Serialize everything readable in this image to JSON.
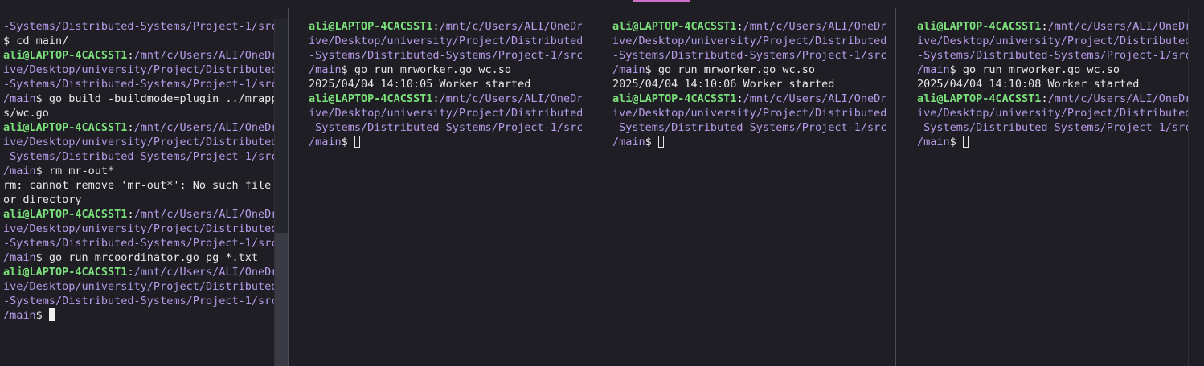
{
  "panes": [
    {
      "lines": [
        {
          "parts": [
            {
              "c": "p",
              "t": "-Systems/Distributed-Systems/Project-1/src"
            }
          ]
        },
        {
          "parts": [
            {
              "c": "w",
              "t": "$ cd main/"
            }
          ]
        },
        {
          "parts": [
            {
              "c": "g",
              "t": "ali@LAPTOP-4CACSST1"
            },
            {
              "c": "w",
              "t": ":"
            },
            {
              "c": "p",
              "t": "/mnt/c/Users/ALI/OneDr"
            }
          ]
        },
        {
          "parts": [
            {
              "c": "p",
              "t": "ive/Desktop/university/Project/Distributed"
            }
          ]
        },
        {
          "parts": [
            {
              "c": "p",
              "t": "-Systems/Distributed-Systems/Project-1/src"
            }
          ]
        },
        {
          "parts": [
            {
              "c": "p",
              "t": "/main"
            },
            {
              "c": "w",
              "t": "$ go build -buildmode=plugin ../mrapp"
            }
          ]
        },
        {
          "parts": [
            {
              "c": "w",
              "t": "s/wc.go"
            }
          ]
        },
        {
          "parts": [
            {
              "c": "g",
              "t": "ali@LAPTOP-4CACSST1"
            },
            {
              "c": "w",
              "t": ":"
            },
            {
              "c": "p",
              "t": "/mnt/c/Users/ALI/OneDr"
            }
          ]
        },
        {
          "parts": [
            {
              "c": "p",
              "t": "ive/Desktop/university/Project/Distributed"
            }
          ]
        },
        {
          "parts": [
            {
              "c": "p",
              "t": "-Systems/Distributed-Systems/Project-1/src"
            }
          ]
        },
        {
          "parts": [
            {
              "c": "p",
              "t": "/main"
            },
            {
              "c": "w",
              "t": "$ rm mr-out*"
            }
          ]
        },
        {
          "parts": [
            {
              "c": "w",
              "t": "rm: cannot remove 'mr-out*': No such file"
            }
          ]
        },
        {
          "parts": [
            {
              "c": "w",
              "t": "or directory"
            }
          ]
        },
        {
          "parts": [
            {
              "c": "g",
              "t": "ali@LAPTOP-4CACSST1"
            },
            {
              "c": "w",
              "t": ":"
            },
            {
              "c": "p",
              "t": "/mnt/c/Users/ALI/OneDr"
            }
          ]
        },
        {
          "parts": [
            {
              "c": "p",
              "t": "ive/Desktop/university/Project/Distributed"
            }
          ]
        },
        {
          "parts": [
            {
              "c": "p",
              "t": "-Systems/Distributed-Systems/Project-1/src"
            }
          ]
        },
        {
          "parts": [
            {
              "c": "p",
              "t": "/main"
            },
            {
              "c": "w",
              "t": "$ go run mrcoordinator.go pg-*.txt"
            }
          ]
        },
        {
          "parts": [
            {
              "c": "g",
              "t": "ali@LAPTOP-4CACSST1"
            },
            {
              "c": "w",
              "t": ":"
            },
            {
              "c": "p",
              "t": "/mnt/c/Users/ALI/OneDr"
            }
          ]
        },
        {
          "parts": [
            {
              "c": "p",
              "t": "ive/Desktop/university/Project/Distributed"
            }
          ]
        },
        {
          "parts": [
            {
              "c": "p",
              "t": "-Systems/Distributed-Systems/Project-1/src"
            }
          ]
        },
        {
          "parts": [
            {
              "c": "p",
              "t": "/main"
            },
            {
              "c": "w",
              "t": "$ "
            }
          ],
          "cursor": "block"
        }
      ]
    },
    {
      "lines": [
        {
          "parts": [
            {
              "c": "g",
              "t": "ali@LAPTOP-4CACSST1"
            },
            {
              "c": "w",
              "t": ":"
            },
            {
              "c": "p",
              "t": "/mnt/c/Users/ALI/OneDr"
            }
          ]
        },
        {
          "parts": [
            {
              "c": "p",
              "t": "ive/Desktop/university/Project/Distributed"
            }
          ]
        },
        {
          "parts": [
            {
              "c": "p",
              "t": "-Systems/Distributed-Systems/Project-1/src"
            }
          ]
        },
        {
          "parts": [
            {
              "c": "p",
              "t": "/main"
            },
            {
              "c": "w",
              "t": "$ go run mrworker.go wc.so"
            }
          ]
        },
        {
          "parts": [
            {
              "c": "w",
              "t": "2025/04/04 14:10:05 Worker started"
            }
          ]
        },
        {
          "parts": [
            {
              "c": "g",
              "t": "ali@LAPTOP-4CACSST1"
            },
            {
              "c": "w",
              "t": ":"
            },
            {
              "c": "p",
              "t": "/mnt/c/Users/ALI/OneDr"
            }
          ]
        },
        {
          "parts": [
            {
              "c": "p",
              "t": "ive/Desktop/university/Project/Distributed"
            }
          ]
        },
        {
          "parts": [
            {
              "c": "p",
              "t": "-Systems/Distributed-Systems/Project-1/src"
            }
          ]
        },
        {
          "parts": [
            {
              "c": "p",
              "t": "/main"
            },
            {
              "c": "w",
              "t": "$ "
            }
          ],
          "cursor": "hollow"
        }
      ]
    },
    {
      "lines": [
        {
          "parts": [
            {
              "c": "g",
              "t": "ali@LAPTOP-4CACSST1"
            },
            {
              "c": "w",
              "t": ":"
            },
            {
              "c": "p",
              "t": "/mnt/c/Users/ALI/OneDr"
            }
          ]
        },
        {
          "parts": [
            {
              "c": "p",
              "t": "ive/Desktop/university/Project/Distributed"
            }
          ]
        },
        {
          "parts": [
            {
              "c": "p",
              "t": "-Systems/Distributed-Systems/Project-1/src"
            }
          ]
        },
        {
          "parts": [
            {
              "c": "p",
              "t": "/main"
            },
            {
              "c": "w",
              "t": "$ go run mrworker.go wc.so"
            }
          ]
        },
        {
          "parts": [
            {
              "c": "w",
              "t": "2025/04/04 14:10:06 Worker started"
            }
          ]
        },
        {
          "parts": [
            {
              "c": "g",
              "t": "ali@LAPTOP-4CACSST1"
            },
            {
              "c": "w",
              "t": ":"
            },
            {
              "c": "p",
              "t": "/mnt/c/Users/ALI/OneDr"
            }
          ]
        },
        {
          "parts": [
            {
              "c": "p",
              "t": "ive/Desktop/university/Project/Distributed"
            }
          ]
        },
        {
          "parts": [
            {
              "c": "p",
              "t": "-Systems/Distributed-Systems/Project-1/src"
            }
          ]
        },
        {
          "parts": [
            {
              "c": "p",
              "t": "/main"
            },
            {
              "c": "w",
              "t": "$ "
            }
          ],
          "cursor": "hollow"
        }
      ]
    },
    {
      "lines": [
        {
          "parts": [
            {
              "c": "g",
              "t": "ali@LAPTOP-4CACSST1"
            },
            {
              "c": "w",
              "t": ":"
            },
            {
              "c": "p",
              "t": "/mnt/c/Users/ALI/OneDr"
            }
          ]
        },
        {
          "parts": [
            {
              "c": "p",
              "t": "ive/Desktop/university/Project/Distributed"
            }
          ]
        },
        {
          "parts": [
            {
              "c": "p",
              "t": "-Systems/Distributed-Systems/Project-1/src"
            }
          ]
        },
        {
          "parts": [
            {
              "c": "p",
              "t": "/main"
            },
            {
              "c": "w",
              "t": "$ go run mrworker.go wc.so"
            }
          ]
        },
        {
          "parts": [
            {
              "c": "w",
              "t": "2025/04/04 14:10:08 Worker started"
            }
          ]
        },
        {
          "parts": [
            {
              "c": "g",
              "t": "ali@LAPTOP-4CACSST1"
            },
            {
              "c": "w",
              "t": ":"
            },
            {
              "c": "p",
              "t": "/mnt/c/Users/ALI/OneDr"
            }
          ]
        },
        {
          "parts": [
            {
              "c": "p",
              "t": "ive/Desktop/university/Project/Distributed"
            }
          ]
        },
        {
          "parts": [
            {
              "c": "p",
              "t": "-Systems/Distributed-Systems/Project-1/src"
            }
          ]
        },
        {
          "parts": [
            {
              "c": "p",
              "t": "/main"
            },
            {
              "c": "w",
              "t": "$ "
            }
          ],
          "cursor": "hollow"
        }
      ]
    }
  ],
  "colors": {
    "background": "#1e1e24",
    "prompt_user": "#7be07b",
    "prompt_path": "#b69be8",
    "text": "#e8e8e8",
    "active_tab_accent": "#d070c8"
  }
}
